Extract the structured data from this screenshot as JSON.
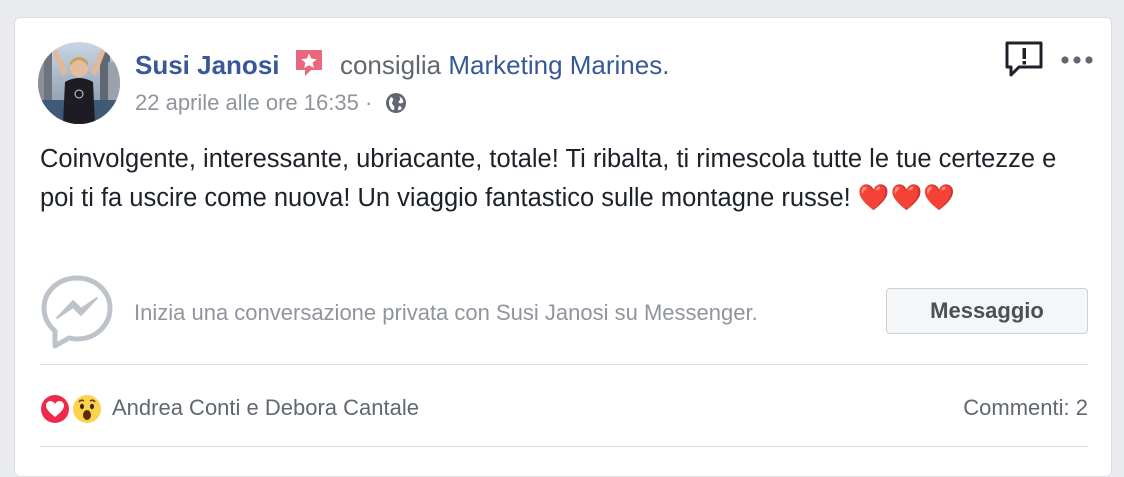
{
  "post": {
    "author": "Susi Janosi",
    "action": "consiglia",
    "page_name": "Marketing Marines",
    "page_suffix": ".",
    "timestamp": "22 aprile alle ore 16:35",
    "separator": "·",
    "privacy_icon": "globe-icon",
    "recommendation_icon": "recommendation-star-icon",
    "body": "Coinvolgente, interessante, ubriacante, totale! Ti ribalta, ti rimescola tutte le tue certezze e poi ti fa uscire come nuova! Un viaggio fantastico sulle montagne russe!",
    "emoji": "❤️❤️❤️"
  },
  "messenger": {
    "prompt": "Inizia una conversazione privata con Susi Janosi su Messenger.",
    "button_label": "Messaggio",
    "icon": "messenger-icon"
  },
  "reactions": {
    "names": "Andrea Conti e Debora Cantale",
    "icons": [
      "love-reaction-icon",
      "wow-reaction-icon"
    ],
    "comments_label": "Commenti: 2"
  },
  "colors": {
    "link": "#385898",
    "secondary_text": "#90949c",
    "body_text": "#1d2129",
    "badge_pink": "#e9677d",
    "background": "#e9ebee"
  }
}
